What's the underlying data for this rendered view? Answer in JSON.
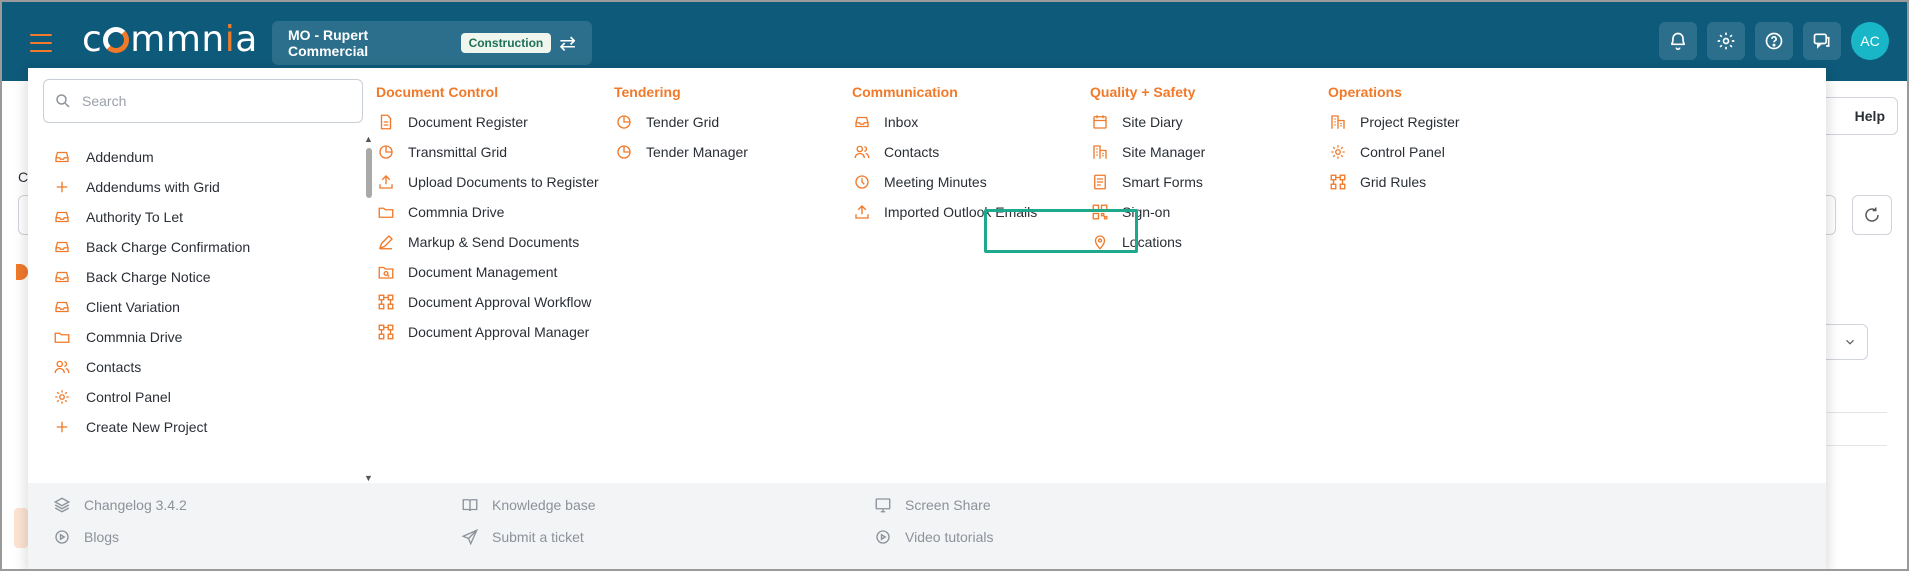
{
  "header": {
    "logo_text": "commnia",
    "project_name": "MO - Rupert Commercial",
    "project_tag": "Construction",
    "avatar_initials": "AC"
  },
  "background": {
    "help_label": "Help",
    "c_label": "C"
  },
  "search": {
    "placeholder": "Search",
    "value": ""
  },
  "left_list": [
    {
      "label": "Addendum",
      "icon": "inbox-icon"
    },
    {
      "label": "Addendums with Grid",
      "icon": "plus-icon"
    },
    {
      "label": "Authority To Let",
      "icon": "inbox-icon"
    },
    {
      "label": "Back Charge Confirmation",
      "icon": "inbox-icon"
    },
    {
      "label": "Back Charge Notice",
      "icon": "inbox-icon"
    },
    {
      "label": "Client Variation",
      "icon": "inbox-icon"
    },
    {
      "label": "Commnia Drive",
      "icon": "folder-icon"
    },
    {
      "label": "Contacts",
      "icon": "users-icon"
    },
    {
      "label": "Control Panel",
      "icon": "gear-icon"
    },
    {
      "label": "Create New Project",
      "icon": "plus-icon"
    }
  ],
  "columns": [
    {
      "title": "Document Control",
      "items": [
        {
          "label": "Document Register",
          "icon": "document-icon"
        },
        {
          "label": "Transmittal Grid",
          "icon": "pie-chart-icon"
        },
        {
          "label": "Upload Documents to Register",
          "icon": "upload-icon"
        },
        {
          "label": "Commnia Drive",
          "icon": "folder-icon"
        },
        {
          "label": "Markup & Send Documents",
          "icon": "pen-icon"
        },
        {
          "label": "Document Management",
          "icon": "folder-search-icon"
        },
        {
          "label": "Document Approval Workflow",
          "icon": "workflow-icon"
        },
        {
          "label": "Document Approval Manager",
          "icon": "workflow-icon"
        }
      ]
    },
    {
      "title": "Tendering",
      "items": [
        {
          "label": "Tender Grid",
          "icon": "pie-chart-icon"
        },
        {
          "label": "Tender Manager",
          "icon": "pie-chart-icon"
        }
      ]
    },
    {
      "title": "Communication",
      "items": [
        {
          "label": "Inbox",
          "icon": "inbox-icon"
        },
        {
          "label": "Contacts",
          "icon": "users-icon"
        },
        {
          "label": "Meeting Minutes",
          "icon": "clock-icon"
        },
        {
          "label": "Imported Outlook Emails",
          "icon": "upload-icon"
        }
      ]
    },
    {
      "title": "Quality + Safety",
      "items": [
        {
          "label": "Site Diary",
          "icon": "calendar-icon"
        },
        {
          "label": "Site Manager",
          "icon": "building-icon"
        },
        {
          "label": "Smart Forms",
          "icon": "form-icon"
        },
        {
          "label": "Sign-on",
          "icon": "qr-icon"
        },
        {
          "label": "Locations",
          "icon": "map-pin-icon"
        }
      ]
    },
    {
      "title": "Operations",
      "items": [
        {
          "label": "Project Register",
          "icon": "building-icon"
        },
        {
          "label": "Control Panel",
          "icon": "gear-icon"
        },
        {
          "label": "Grid Rules",
          "icon": "workflow-icon"
        }
      ]
    }
  ],
  "footer": [
    {
      "label": "Changelog 3.4.2",
      "icon": "layers-icon"
    },
    {
      "label": "Blogs",
      "icon": "play-circle-icon"
    },
    {
      "label": "Knowledge base",
      "icon": "book-icon"
    },
    {
      "label": "Submit a ticket",
      "icon": "send-icon"
    },
    {
      "label": "Screen Share",
      "icon": "screen-share-icon"
    },
    {
      "label": "Video tutorials",
      "icon": "play-circle-icon"
    }
  ],
  "colors": {
    "header_bg": "#0e5a7a",
    "accent_orange": "#f07a2a",
    "highlight_green": "#1ea88c",
    "avatar_bg": "#19b6c8"
  }
}
